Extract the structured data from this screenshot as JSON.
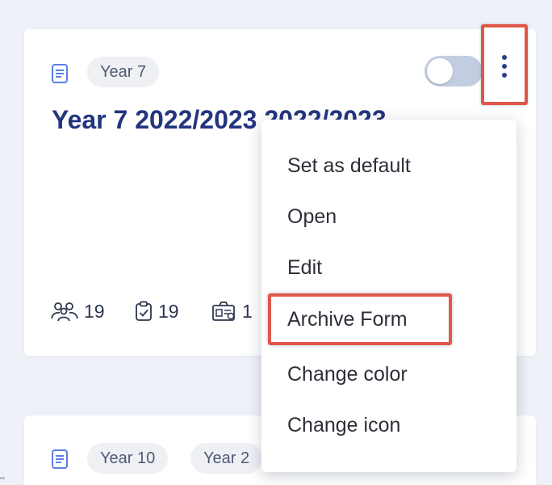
{
  "cards": [
    {
      "tags": [
        "Year 7"
      ],
      "title": "Year 7 2022/2023 2022/2023",
      "toggle_on": false,
      "stats": [
        {
          "icon": "users-icon",
          "value": "19"
        },
        {
          "icon": "clipboard-check-icon",
          "value": "19"
        },
        {
          "icon": "badge-icon",
          "value": "1"
        }
      ]
    },
    {
      "tags": [
        "Year 10",
        "Year 2"
      ]
    }
  ],
  "menu": {
    "items": [
      {
        "label": "Set as default"
      },
      {
        "label": "Open"
      },
      {
        "label": "Edit"
      },
      {
        "label": "Archive Form"
      },
      {
        "label": "Change color"
      },
      {
        "label": "Change icon"
      }
    ]
  },
  "colors": {
    "title": "#23357e",
    "accent_icon": "#5b7ee5",
    "highlight_border": "#e0574a",
    "background": "#eef1f7"
  }
}
